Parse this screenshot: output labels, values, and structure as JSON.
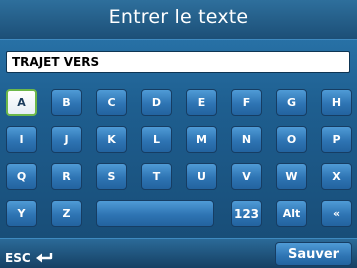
{
  "header": {
    "title": "Entrer le texte"
  },
  "input": {
    "value": "TRAJET VERS"
  },
  "keyboard": {
    "row1": [
      "A",
      "B",
      "C",
      "D",
      "E",
      "F",
      "G",
      "H"
    ],
    "row2": [
      "I",
      "J",
      "K",
      "L",
      "M",
      "N",
      "O",
      "P"
    ],
    "row3": [
      "Q",
      "R",
      "S",
      "T",
      "U",
      "V",
      "W",
      "X"
    ],
    "row4": [
      "Y",
      "Z"
    ],
    "num_label": "123",
    "alt_label": "Alt",
    "back_label": "«",
    "selected_key": "A"
  },
  "footer": {
    "esc_label": "ESC",
    "save_label": "Sauver"
  },
  "colors": {
    "key": "#2e74b3",
    "selected_border": "#6db84a",
    "background": "#1e5e8f"
  }
}
